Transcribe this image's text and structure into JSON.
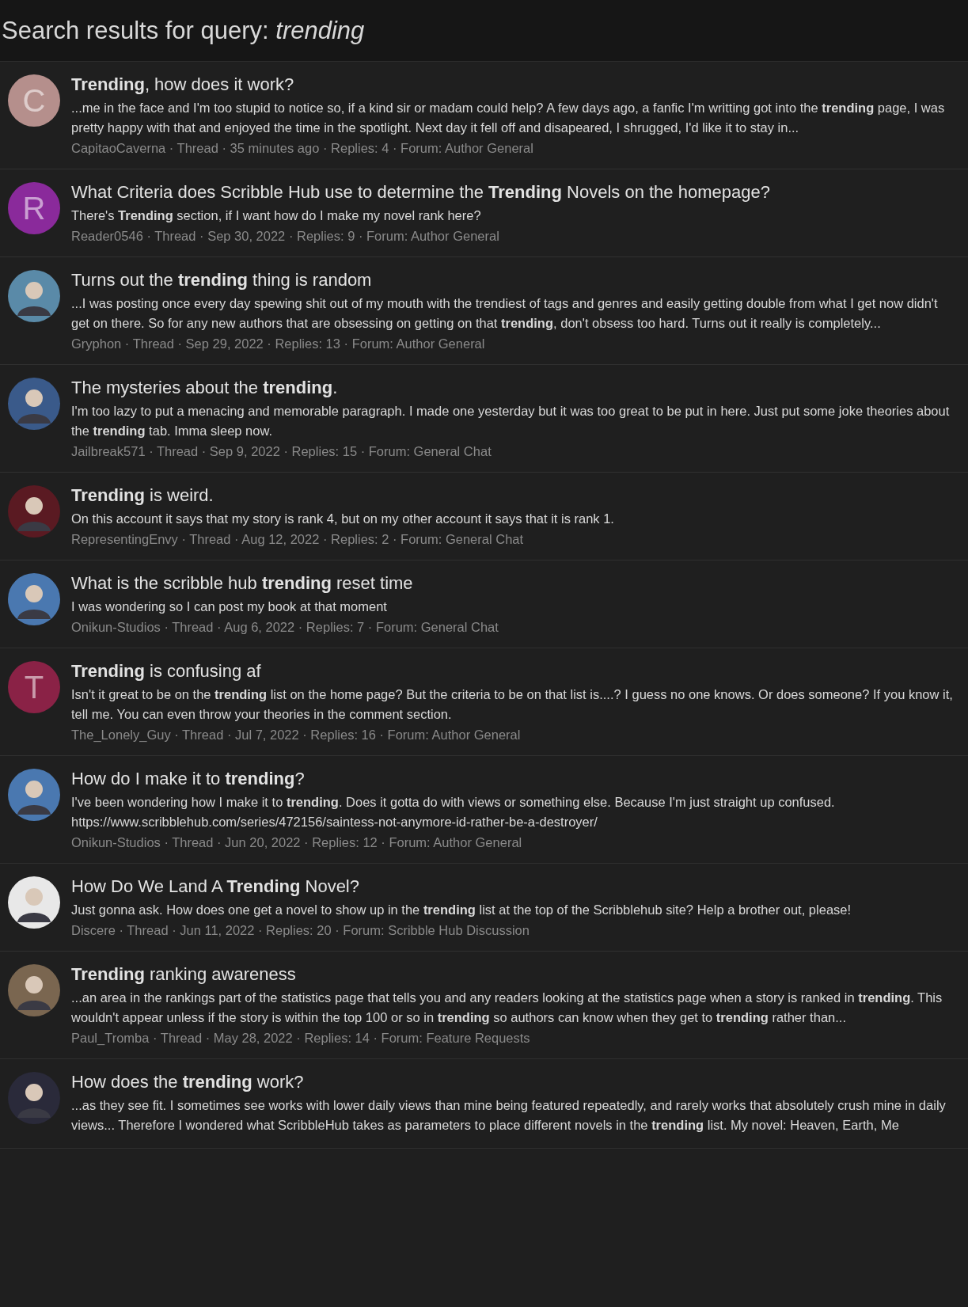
{
  "page_title": "Search results for query: *trending*",
  "results": [
    {
      "avatar": {
        "kind": "letter",
        "letter": "C",
        "color": "#b58f8c"
      },
      "title": "**Trending**, how does it work?",
      "snippet": "...me in the face and I'm too stupid to notice so, if a kind sir or madam could help? A few days ago, a fanfic I'm writting got into the **trending** page, I was pretty happy with that and enjoyed the time in the spotlight. Next day it fell off and disapeared, I shrugged, I'd like it to stay in...",
      "meta": "CapitaoCaverna · Thread · 35 minutes ago · Replies: 4 · Forum: Author General"
    },
    {
      "avatar": {
        "kind": "letter",
        "letter": "R",
        "color": "#8a2a9b"
      },
      "title": "What Criteria does Scribble Hub use to determine the **Trending** Novels on the homepage?",
      "snippet": "There's **Trending** section, if I want how do I make my novel rank here?",
      "meta": "Reader0546 · Thread · Sep 30, 2022 · Replies: 9 · Forum: Author General"
    },
    {
      "avatar": {
        "kind": "picture",
        "color": "#5a8aa8"
      },
      "title": "Turns out the **trending** thing is random",
      "snippet": "...I was posting once every day spewing shit out of my mouth with the trendiest of tags and genres and easily getting double from what I get now didn't get on there. So for any new authors that are obsessing on getting on that **trending**, don't obsess too hard. Turns out it really is completely...",
      "meta": "Gryphon · Thread · Sep 29, 2022 · Replies: 13 · Forum: Author General"
    },
    {
      "avatar": {
        "kind": "picture",
        "color": "#3a5a8a"
      },
      "title": "The mysteries about the **trending**.",
      "snippet": "I'm too lazy to put a menacing and memorable paragraph. I made one yesterday but it was too great to be put in here. Just put some joke theories about the **trending** tab. Imma sleep now.",
      "meta": "Jailbreak571 · Thread · Sep 9, 2022 · Replies: 15 · Forum: General Chat"
    },
    {
      "avatar": {
        "kind": "picture",
        "color": "#5a1a22"
      },
      "title": "**Trending** is weird.",
      "snippet": "On this account it says that my story is rank 4, but on my other account it says that it is rank 1.",
      "meta": "RepresentingEnvy · Thread · Aug 12, 2022 · Replies: 2 · Forum: General Chat"
    },
    {
      "avatar": {
        "kind": "picture",
        "color": "#4a78b0"
      },
      "title": "What is the scribble hub **trending** reset time",
      "snippet": "I was wondering so I can post my book at that moment",
      "meta": "Onikun-Studios · Thread · Aug 6, 2022 · Replies: 7 · Forum: General Chat"
    },
    {
      "avatar": {
        "kind": "letter",
        "letter": "T",
        "color": "#8a2246"
      },
      "title": "**Trending** is confusing af",
      "snippet": "Isn't it great to be on the **trending** list on the home page? But the criteria to be on that list is....? I guess no one knows. Or does someone? If you know it, tell me. You can even throw your theories in the comment section.",
      "meta": "The_Lonely_Guy · Thread · Jul 7, 2022 · Replies: 16 · Forum: Author General"
    },
    {
      "avatar": {
        "kind": "picture",
        "color": "#4a78b0"
      },
      "title": "How do I make it to **trending**?",
      "snippet": "I've been wondering how I make it to **trending**. Does it gotta do with views or something else. Because I'm just straight up confused. https://www.scribblehub.com/series/472156/saintess-not-anymore-id-rather-be-a-destroyer/",
      "meta": "Onikun-Studios · Thread · Jun 20, 2022 · Replies: 12 · Forum: Author General"
    },
    {
      "avatar": {
        "kind": "picture",
        "color": "#e8e8e8"
      },
      "title": "How Do We Land A **Trending** Novel?",
      "snippet": "Just gonna ask. How does one get a novel to show up in the **trending** list at the top of the Scribblehub site? Help a brother out, please!",
      "meta": "Discere · Thread · Jun 11, 2022 · Replies: 20 · Forum: Scribble Hub Discussion"
    },
    {
      "avatar": {
        "kind": "picture",
        "color": "#7a6650"
      },
      "title": "**Trending** ranking awareness",
      "snippet": "...an area in the rankings part of the statistics page that tells you and any readers looking at the statistics page when a story is ranked in **trending**. This wouldn't appear unless if the story is within the top 100 or so in **trending** so authors can know when they get to **trending** rather than...",
      "meta": "Paul_Tromba · Thread · May 28, 2022 · Replies: 14 · Forum: Feature Requests"
    },
    {
      "avatar": {
        "kind": "picture",
        "color": "#2a2a3a"
      },
      "title": "How does the **trending** work?",
      "snippet": "...as they see fit. I sometimes see works with lower daily views than mine being featured repeatedly, and rarely works that absolutely crush mine in daily views... Therefore I wondered what ScribbleHub takes as parameters to place different novels in the **trending** list. My novel: Heaven, Earth, Me"
    }
  ]
}
